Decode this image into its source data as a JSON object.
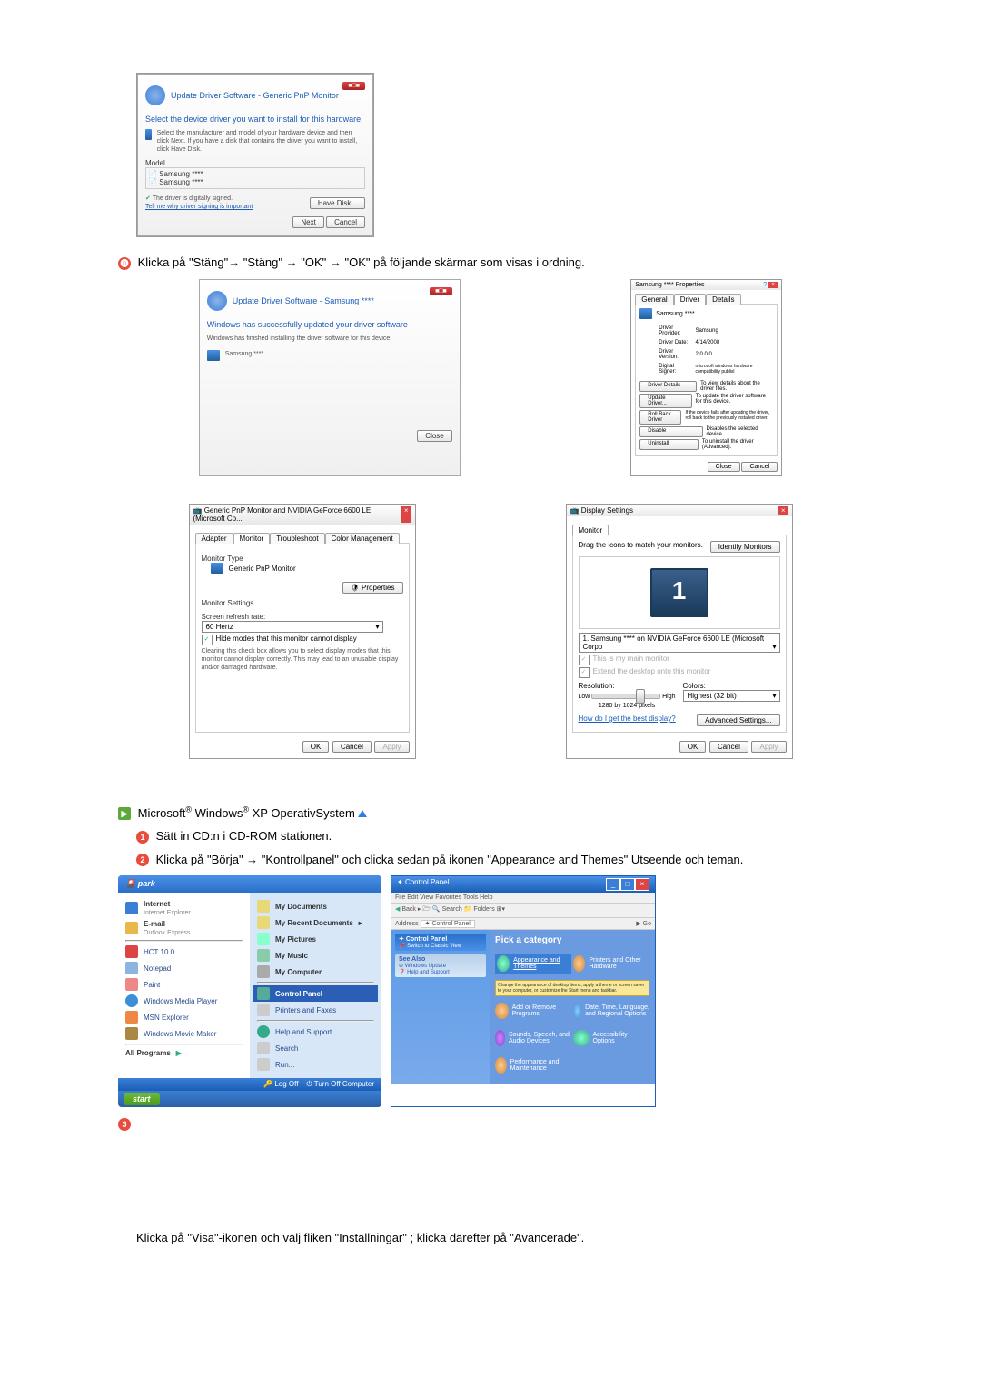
{
  "dialog1": {
    "header_red": "■□■",
    "breadcrumb": "Update Driver Software - Generic PnP Monitor",
    "title": "Select the device driver you want to install for this hardware.",
    "desc": "Select the manufacturer and model of your hardware device and then click Next. If you have a disk that contains the driver you want to install, click Have Disk.",
    "model_label": "Model",
    "model1": "Samsung ****",
    "model2": "Samsung ****",
    "signed": "The driver is digitally signed.",
    "tell_me": "Tell me why driver signing is important",
    "have_disk": "Have Disk...",
    "next": "Next",
    "cancel": "Cancel"
  },
  "instruction_step_close": "Klicka på \"Stäng\"→ \"Stäng\" → \"OK\" → \"OK\" på följande skärmar som visas i ordning.",
  "dialog_success": {
    "breadcrumb": "Update Driver Software - Samsung ****",
    "title": "Windows has successfully updated your driver software",
    "desc": "Windows has finished installing the driver software for this device:",
    "device": "Samsung ****",
    "close": "Close"
  },
  "dialog_props": {
    "title": "Samsung **** Properties",
    "tab_general": "General",
    "tab_driver": "Driver",
    "tab_details": "Details",
    "device": "Samsung ****",
    "provider_lbl": "Driver Provider:",
    "provider": "Samsung",
    "date_lbl": "Driver Date:",
    "date": "4/14/2008",
    "version_lbl": "Driver Version:",
    "version": "2.0.0.0",
    "signer_lbl": "Digital Signer:",
    "signer": "microsoft windows hardware compatibility publisl",
    "btn_details": "Driver Details",
    "btn_details_desc": "To view details about the driver files.",
    "btn_update": "Update Driver...",
    "btn_update_desc": "To update the driver software for this device.",
    "btn_rollback": "Roll Back Driver",
    "btn_rollback_desc": "If the device fails after updating the driver, roll back to the previously installed driver.",
    "btn_disable": "Disable",
    "btn_disable_desc": "Disables the selected device.",
    "btn_uninstall": "Uninstall",
    "btn_uninstall_desc": "To uninstall the driver (Advanced).",
    "close": "Close",
    "cancel": "Cancel"
  },
  "dialog_monitor_tabs": {
    "title": "Generic PnP Monitor and NVIDIA GeForce 6600 LE (Microsoft Co...",
    "tab_adapter": "Adapter",
    "tab_monitor": "Monitor",
    "tab_troubleshoot": "Troubleshoot",
    "tab_color": "Color Management",
    "type_lbl": "Monitor Type",
    "type": "Generic PnP Monitor",
    "properties": "Properties",
    "settings_lbl": "Monitor Settings",
    "refresh_lbl": "Screen refresh rate:",
    "refresh": "60 Hertz",
    "hide_modes": "Hide modes that this monitor cannot display",
    "warning": "Clearing this check box allows you to select display modes that this monitor cannot display correctly. This may lead to an unusable display and/or damaged hardware.",
    "ok": "OK",
    "cancel": "Cancel",
    "apply": "Apply"
  },
  "dialog_display": {
    "title": "Display Settings",
    "tab_monitor": "Monitor",
    "drag": "Drag the icons to match your monitors.",
    "identify": "Identify Monitors",
    "num": "1",
    "adapter": "1. Samsung **** on NVIDIA GeForce 6600 LE (Microsoft Corpo",
    "main_monitor": "This is my main monitor",
    "extend": "Extend the desktop onto this monitor",
    "resolution": "Resolution:",
    "low": "Low",
    "high": "High",
    "res_value": "1280 by 1024 pixels",
    "colors": "Colors:",
    "color_value": "Highest (32 bit)",
    "best_display": "How do I get the best display?",
    "advanced": "Advanced Settings...",
    "ok": "OK",
    "cancel": "Cancel",
    "apply": "Apply"
  },
  "xp_heading": "Microsoft® Windows® XP OperativSystem",
  "step1": "Sätt in CD:n i CD-ROM stationen.",
  "step2": "Klicka på \"Börja\" → \"Kontrollpanel\" och clicka sedan på ikonen \"Appearance and Themes\" Utseende och teman.",
  "start_menu": {
    "user": "park",
    "internet": "Internet",
    "internet_sub": "Internet Explorer",
    "email": "E-mail",
    "email_sub": "Outlook Express",
    "hct": "HCT 10.0",
    "notepad": "Notepad",
    "paint": "Paint",
    "wmp": "Windows Media Player",
    "msn": "MSN Explorer",
    "wmm": "Windows Movie Maker",
    "all_programs": "All Programs",
    "my_docs": "My Documents",
    "recent": "My Recent Documents",
    "my_pics": "My Pictures",
    "my_music": "My Music",
    "my_computer": "My Computer",
    "control_panel": "Control Panel",
    "printers": "Printers and Faxes",
    "help": "Help and Support",
    "search": "Search",
    "run": "Run...",
    "logoff": "Log Off",
    "turnoff": "Turn Off Computer",
    "start_btn": "start"
  },
  "control_panel": {
    "title": "Control Panel",
    "menu": "File   Edit   View   Favorites   Tools   Help",
    "nav_back": "Back",
    "address": "Address",
    "address_val": "Control Panel",
    "side1": "Control Panel",
    "side1a": "Switch to Classic View",
    "side2": "See Also",
    "side2a": "Windows Update",
    "side2b": "Help and Support",
    "pick": "Pick a category",
    "cat1": "Appearance and Themes",
    "cat1_desc": "Change the appearance of desktop items, apply a theme or screen saver to your computer, or customize the Start menu and taskbar.",
    "cat2": "Printers and Other Hardware",
    "cat3": "Add or Remove Programs",
    "cat4": "Date, Time, Language, and Regional Options",
    "cat5": "Sounds, Speech, and Audio Devices",
    "cat6": "Accessibility Options",
    "cat7": "Performance and Maintenance"
  },
  "bottom_instruction": "Klicka på \"Visa\"-ikonen och välj fliken \"Inställningar\" ; klicka därefter på \"Avancerade\"."
}
